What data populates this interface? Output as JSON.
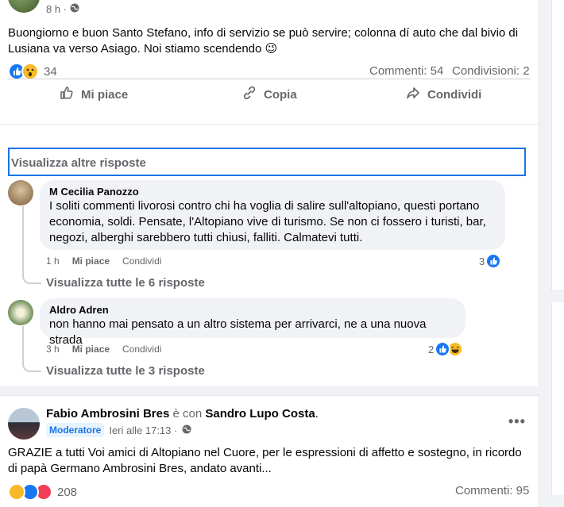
{
  "post1": {
    "time": "8 h ·",
    "text": "Buongiorno e buon Santo Stefano, info di servizio se può servire; colonna dí auto che dal bivio di Lusiana va verso Asiago. Noi stiamo scendendo 😉",
    "reactions_count": "34",
    "comments": "Commenti: 54",
    "shares": "Condivisioni: 2",
    "actions": {
      "like": "Mi piace",
      "copy": "Copia",
      "share": "Condividi"
    }
  },
  "view_more_replies": "Visualizza altre risposte",
  "comments": [
    {
      "name": "M Cecilia Panozzo",
      "text": "I soliti commenti livorosi contro chi ha voglia di salire sull'altopiano, questi portano economia, soldi. Pensate, l'Altopiano vive di turismo. Se non ci fossero i turisti, bar, negozi, alberghi sarebbero tutti chiusi, falliti. Calmatevi tutti.",
      "time": "1 h",
      "like": "Mi piace",
      "reply": "Condividi",
      "reaction_count": "3",
      "view_replies": "Visualizza tutte le 6 risposte"
    },
    {
      "name": "Aldro Adren",
      "text": "non hanno mai pensato a un altro sistema per arrivarci, ne a una nuova strada",
      "time": "3 h",
      "like": "Mi piace",
      "reply": "Condividi",
      "reaction_count": "2",
      "view_replies": "Visualizza tutte le 3 risposte"
    }
  ],
  "post2": {
    "author": "Fabio Ambrosini Bres",
    "with_label": "è con",
    "with_name": "Sandro Lupo Costa",
    "with_end": ".",
    "badge": "Moderatore",
    "time": "Ieri alle 17:13 ·",
    "text": "GRAZIE a tutti Voi amici di Altopiano nel Cuore, per le espressioni di affetto e sostegno, in ricordo di papà Germano Ambrosini Bres, andato avanti...",
    "reactions_count": "208",
    "comments": "Commenti: 95"
  },
  "icons": {
    "globe": "globe-icon",
    "like": "thumb-up-icon",
    "copy": "link-icon",
    "share": "share-arrow-icon",
    "more": "more-dots-icon"
  },
  "colors": {
    "accent": "#1b74e4",
    "like": "#1877f2",
    "haha": "#f7b928",
    "love": "#f33e58"
  }
}
